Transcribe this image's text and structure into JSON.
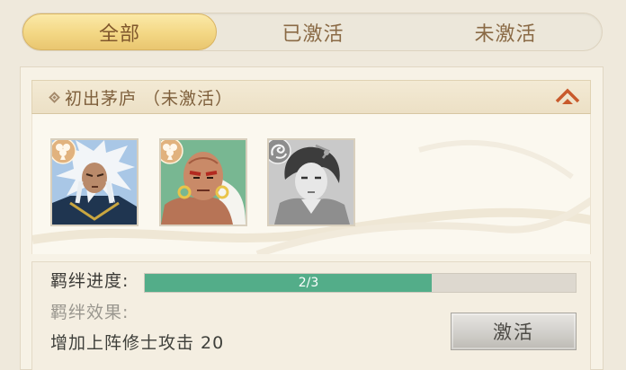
{
  "tabs": [
    {
      "label": "全部",
      "selected": true
    },
    {
      "label": "已激活",
      "selected": false
    },
    {
      "label": "未激活",
      "selected": false
    }
  ],
  "group": {
    "title": "初出茅庐 （未激活）",
    "members": [
      {
        "character": "white-haired-warrior",
        "badge": "club-badge-icon",
        "grayscale": false
      },
      {
        "character": "bald-monk-with-earrings",
        "badge": "club-badge-icon",
        "grayscale": false
      },
      {
        "character": "scholar-with-hair-ornament",
        "badge": "swirl-badge-icon",
        "grayscale": true
      }
    ]
  },
  "bond": {
    "progress_label": "羁绊进度:",
    "progress_text": "2/3",
    "progress_fraction": 0.667,
    "effect_label": "羁绊效果:",
    "effect_text": "增加上阵修士攻击  20",
    "activate_label": "激活"
  },
  "colors": {
    "accent_gold": "#f3d784",
    "progress_green": "#53ad89",
    "title_brown": "#7e5f3b"
  }
}
